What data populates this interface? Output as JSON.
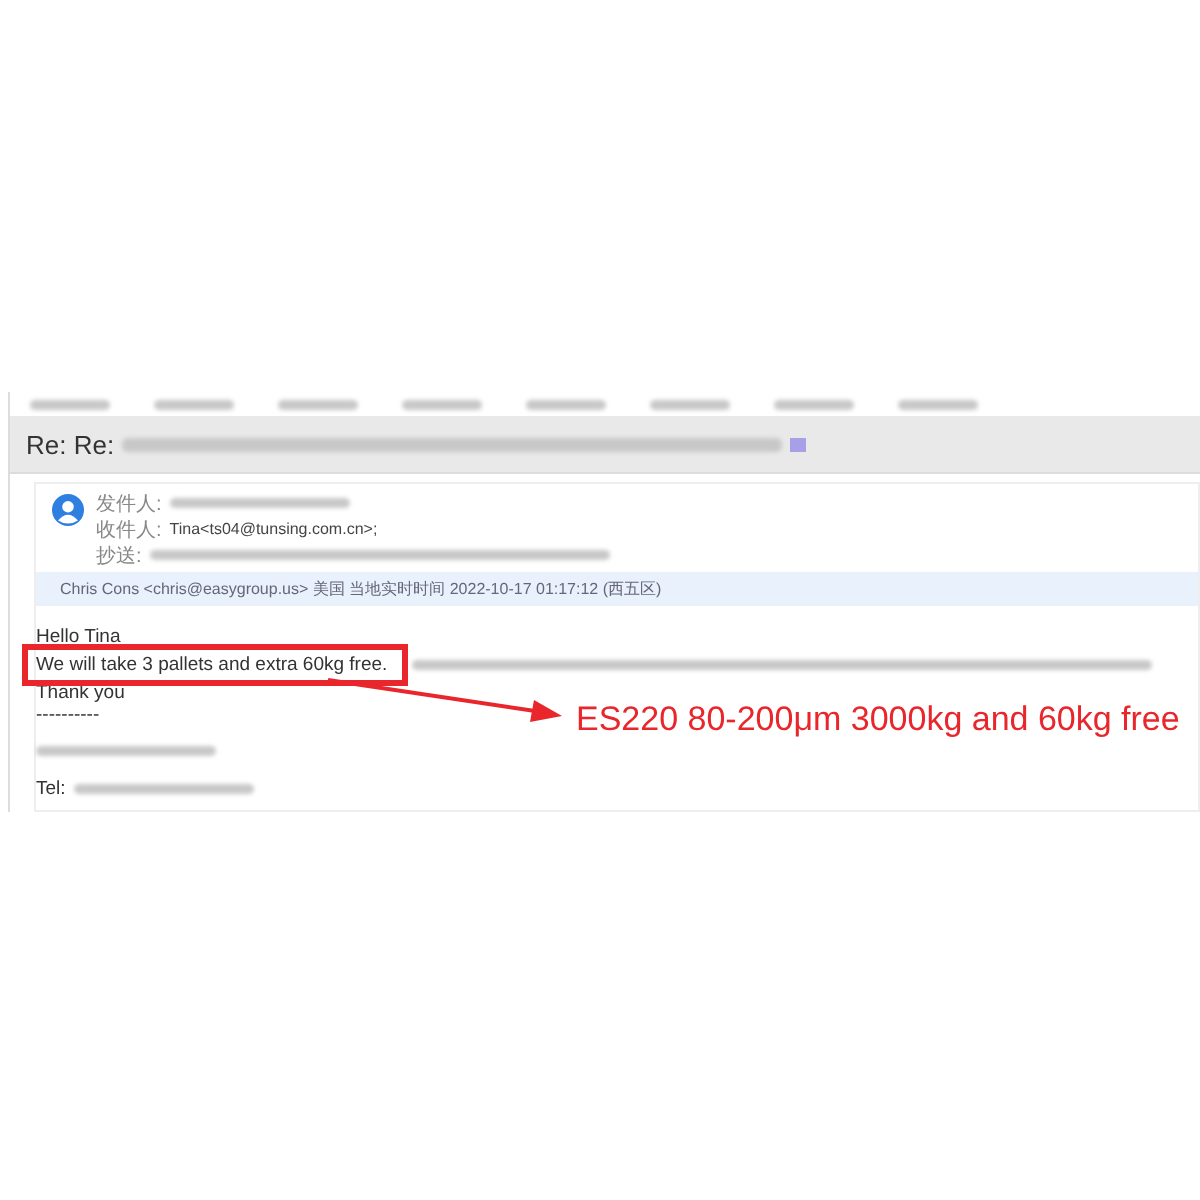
{
  "email": {
    "subject": "Re: Re:",
    "headers": [
      {
        "label": "发件人:"
      },
      {
        "label": "收件人:",
        "value": "Tina<ts04@tunsing.com.cn>;"
      },
      {
        "label": "抄送:"
      }
    ],
    "sender_info": "Chris Cons <chris@easygroup.us> 美国 当地实时时间 2022-10-17 01:17:12 (西五区)",
    "greeting": "Hello Tina",
    "highlighted_line": "We will take 3 pallets and extra 60kg free.",
    "thanks": "Thank you",
    "separator": "----------",
    "tel_label": "Tel:"
  },
  "annotation": {
    "text": "ES220 80-200μm 3000kg and 60kg free"
  }
}
